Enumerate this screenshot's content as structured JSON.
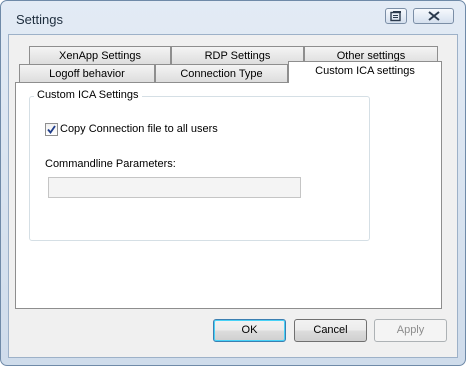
{
  "window": {
    "title": "Settings"
  },
  "titlebar_buttons": {
    "icons": [
      "restore-icon",
      "close-icon"
    ]
  },
  "tabs": {
    "row_top": [
      {
        "label": "XenApp Settings"
      },
      {
        "label": "RDP Settings"
      },
      {
        "label": "Other settings"
      }
    ],
    "row_bottom": [
      {
        "label": "Logoff behavior"
      },
      {
        "label": "Connection Type"
      },
      {
        "label": "Custom ICA settings"
      }
    ],
    "active": "Custom ICA settings"
  },
  "group": {
    "title": "Custom ICA Settings",
    "copy_checkbox": {
      "label": "Copy Connection file to all users",
      "checked": true
    },
    "commandline": {
      "label": "Commandline Parameters:",
      "value": ""
    }
  },
  "buttons": {
    "ok": "OK",
    "cancel": "Cancel",
    "apply": "Apply"
  }
}
